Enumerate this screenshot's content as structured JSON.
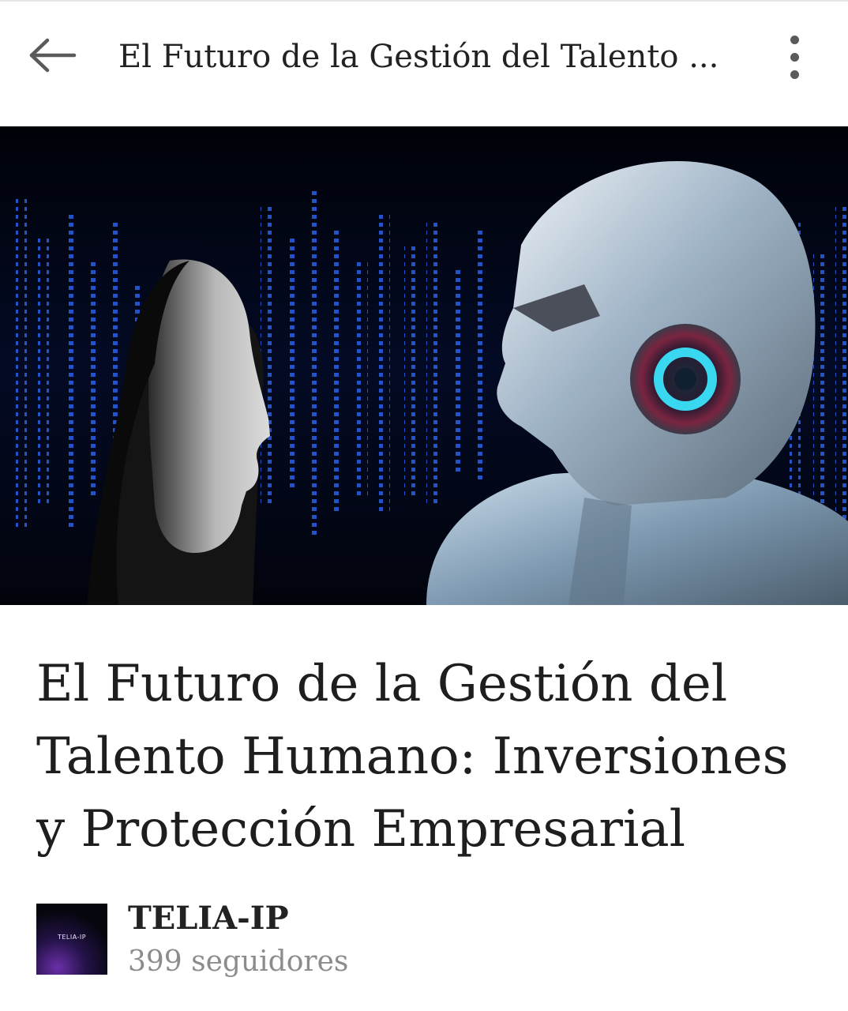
{
  "app_bar": {
    "title": "El Futuro de la Gestión del Talento ..."
  },
  "icons": {
    "back": "arrow-left-icon",
    "more": "more-vertical-icon"
  },
  "hero_image": {
    "subject": "woman-facing-humanoid-robot"
  },
  "article": {
    "title": "El Futuro de la Gestión del Talento Humano: Inversiones y Protección Empresarial"
  },
  "author": {
    "name": "TELIA-IP",
    "avatar_text": "TELIA-IP",
    "followers": "399 seguidores"
  },
  "colors": {
    "background": "#ffffff",
    "text_primary": "#1e1e1e",
    "text_secondary": "#8c8c8c",
    "hero_accent": "#2a7fff",
    "robot_eye": "#3ad8f0"
  }
}
